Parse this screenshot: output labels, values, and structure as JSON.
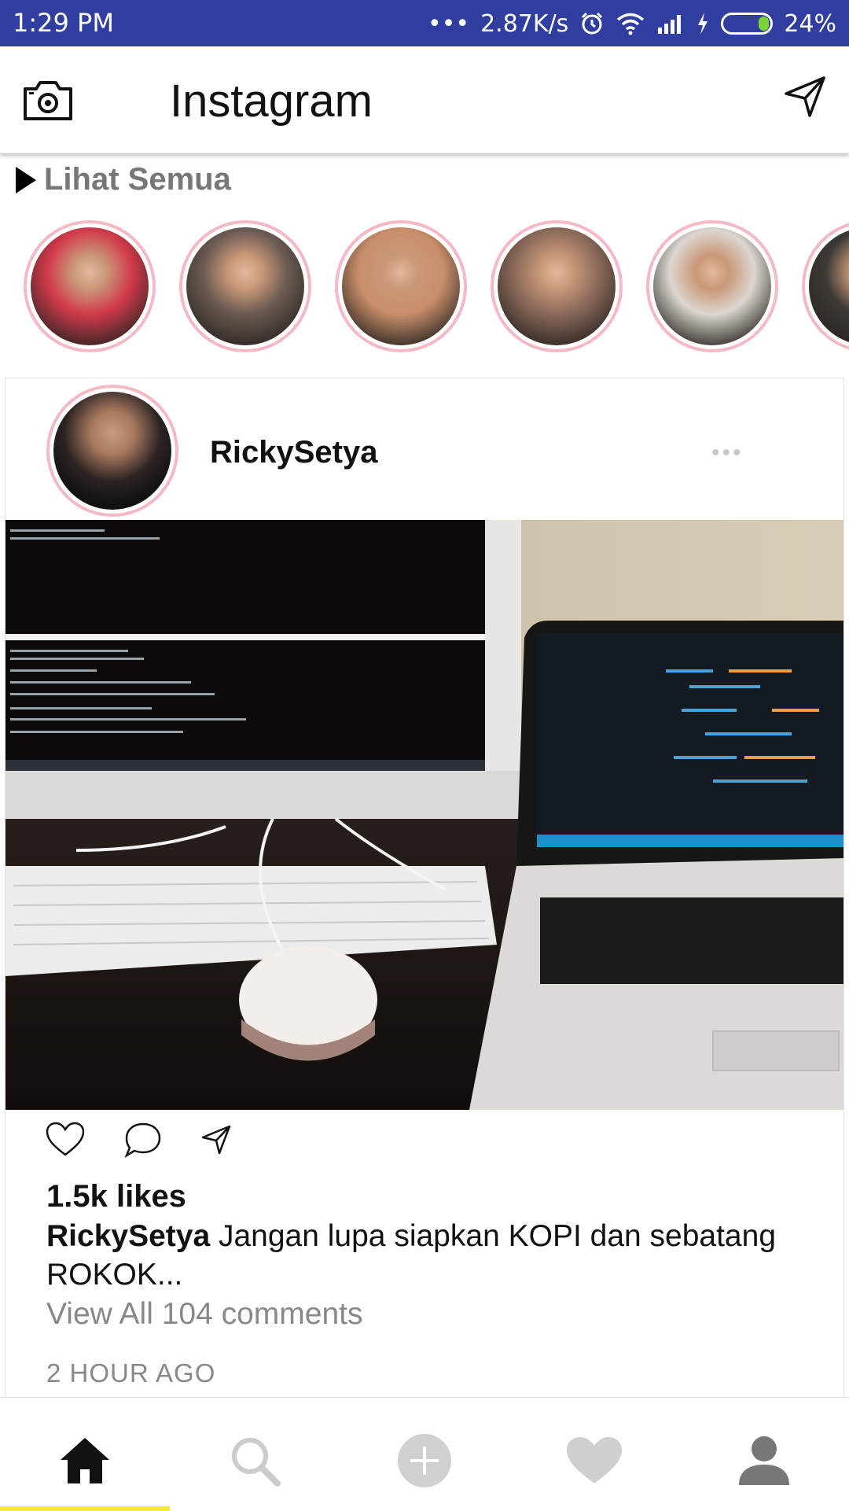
{
  "status_bar": {
    "time": "1:29 PM",
    "signal_dots": "•••",
    "net_speed": "2.87K/s",
    "battery": "24%",
    "battery_level": 0.24,
    "bg_color": "#303f9f"
  },
  "header": {
    "title": "Instagram",
    "camera_icon": "camera-icon",
    "direct_icon": "paper-plane-icon"
  },
  "stories": {
    "see_all": "Lihat Semua",
    "ring_color": "#f5b9c6",
    "items": [
      {
        "icon": "story-avatar",
        "tone": "#d23a4b"
      },
      {
        "icon": "story-avatar",
        "tone": "#6a5a52"
      },
      {
        "icon": "story-avatar",
        "tone": "#c98f6b"
      },
      {
        "icon": "story-avatar",
        "tone": "#8a6a5a"
      },
      {
        "icon": "story-avatar",
        "tone": "#dcd6d0"
      },
      {
        "icon": "story-avatar",
        "tone": "#3c3a36"
      }
    ]
  },
  "post": {
    "username": "RickySetya",
    "more": "•••",
    "likes": "1.5k likes",
    "caption_user": "RickySetya",
    "caption_text": " Jangan lupa siapkan KOPI dan sebatang ROKOK...",
    "view_comments": "View All 104 comments",
    "time": "2 HOUR AGO"
  },
  "bottom_nav": {
    "items": [
      "home-icon",
      "search-icon",
      "add-icon",
      "heart-icon",
      "profile-icon"
    ],
    "active": "home-icon",
    "indicator_color": "#f7ea3a"
  }
}
